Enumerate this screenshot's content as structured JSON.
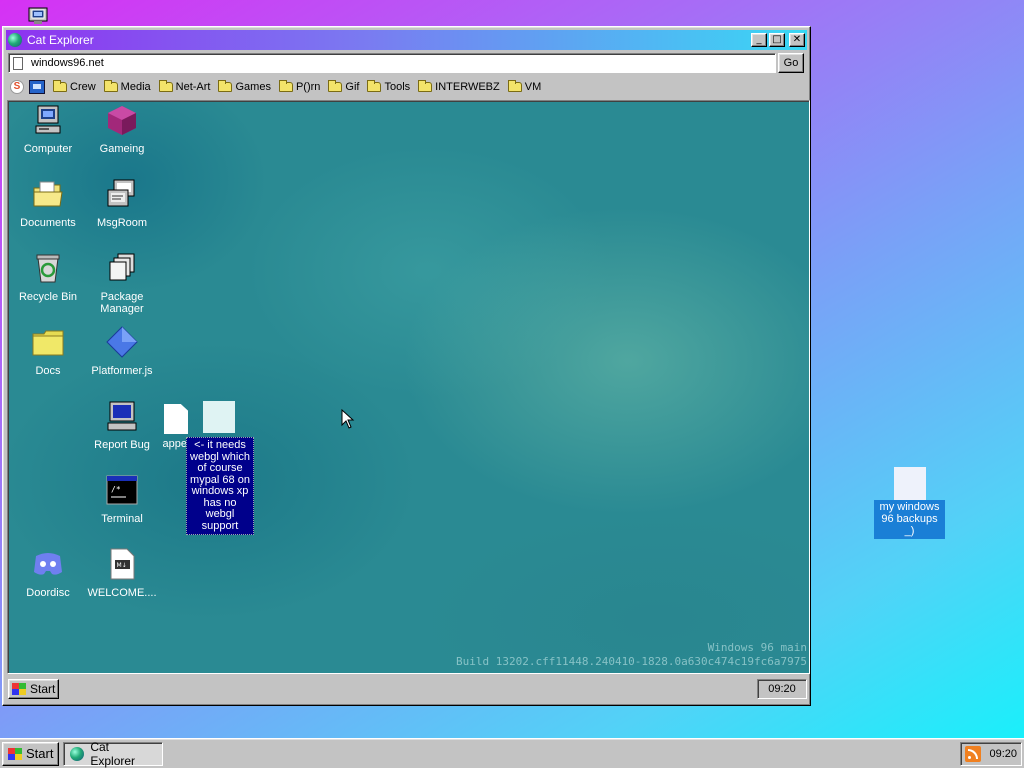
{
  "window": {
    "title": "Cat Explorer",
    "buttons": {
      "minimize": "_",
      "maximize": "□",
      "close": "✕"
    }
  },
  "address_bar": {
    "url": "windows96.net",
    "go_label": "Go"
  },
  "bookmarks": [
    "Crew",
    "Media",
    "Net-Art",
    "Games",
    "P()rn",
    "Gif",
    "Tools",
    "INTERWEBZ",
    "VM"
  ],
  "desktop_icons": [
    {
      "label": "Computer",
      "icon": "computer-icon"
    },
    {
      "label": "Gameing",
      "icon": "cube-icon"
    },
    {
      "label": "Documents",
      "icon": "documents-folder-icon"
    },
    {
      "label": "MsgRoom",
      "icon": "msgroom-icon"
    },
    {
      "label": "Recycle Bin",
      "icon": "recycle-bin-icon"
    },
    {
      "label": "Package Manager",
      "icon": "package-manager-icon"
    },
    {
      "label": "Docs",
      "icon": "folder-icon"
    },
    {
      "label": "Platformer.js",
      "icon": "diamond-icon"
    },
    {
      "label": "Report Bug",
      "icon": "report-bug-icon"
    },
    {
      "label": "Terminal",
      "icon": "terminal-icon"
    },
    {
      "label": "Doordisc",
      "icon": "discord-icon"
    },
    {
      "label": "WELCOME....",
      "icon": "markdown-file-icon"
    }
  ],
  "appl_icon_label": "appel",
  "tooltip": "<- it needs webgl which of course mypal 68 on windows xp has no webgl support",
  "build_info": {
    "line1": "Windows 96 main",
    "line2": "Build 13202.cff11448.240410-1828.0a630c474c19fc6a7975"
  },
  "inner_taskbar": {
    "start_label": "Start",
    "clock": "09:20"
  },
  "outer_desktop_icon": {
    "label": "my windows 96 backups _)"
  },
  "taskbar": {
    "start_label": "Start",
    "task_item": "Cat Explorer",
    "clock": "09:20"
  },
  "colors": {
    "titlebar_start": "#8e32f0",
    "titlebar_end": "#39d8f4",
    "desktop_teal": "#2a8a93",
    "tooltip_bg": "#00008b",
    "selection_blue": "#1a7fd6"
  }
}
